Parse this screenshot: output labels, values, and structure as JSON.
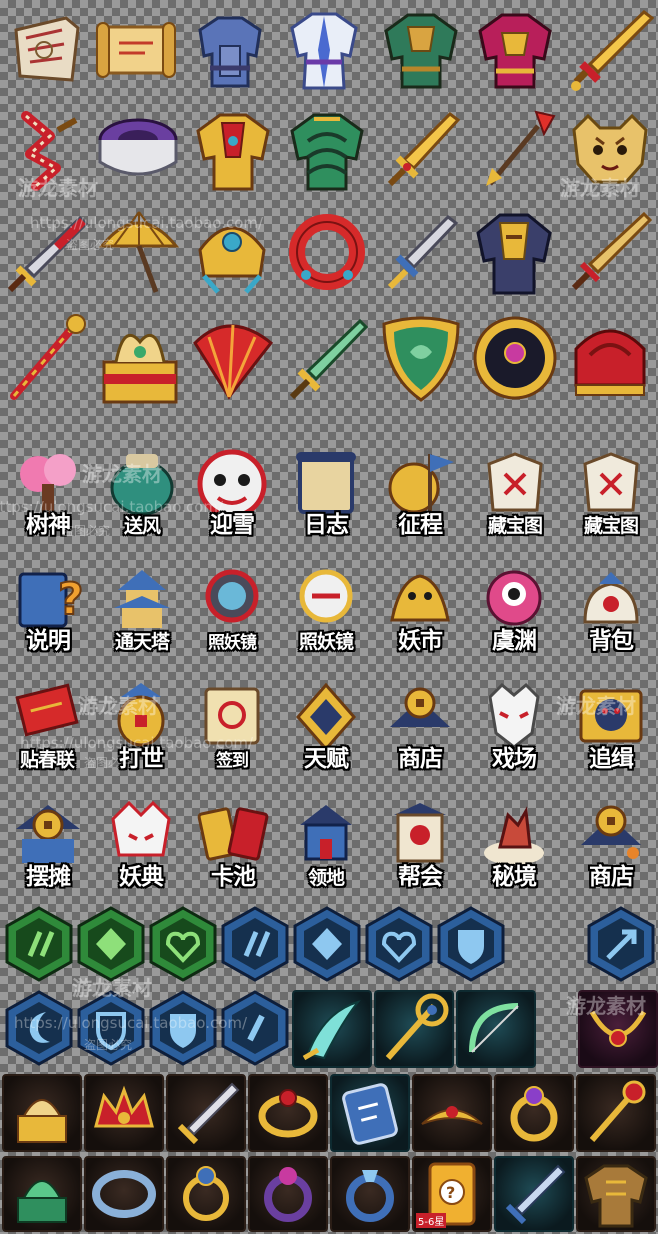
{
  "sheet": {
    "row1_icons": [
      "map-scroll-icon",
      "parchment-scroll-icon",
      "blue-armor-icon",
      "white-robe-icon",
      "green-armor-icon",
      "red-armor-icon",
      "golden-sword-icon"
    ],
    "row2_icons": [
      "red-whip-icon",
      "purple-drum-icon",
      "golden-armor-icon",
      "jade-armor-icon",
      "jeweled-sword-icon",
      "red-spear-icon",
      "tiger-helmet-icon"
    ],
    "row3_icons": [
      "crimson-sword-icon",
      "paper-umbrella-icon",
      "crown-helmet-icon",
      "red-ring-icon",
      "blue-dagger-icon",
      "dark-armor-icon",
      "long-sword-icon"
    ],
    "row4_icons": [
      "golden-staff-icon",
      "phoenix-chest-icon",
      "red-fan-icon",
      "jade-sword-icon",
      "green-shield-icon",
      "eye-orb-icon",
      "red-helmet-icon"
    ],
    "labelled_rows": [
      [
        {
          "label": "树神",
          "icon": "tree-spirit-icon"
        },
        {
          "label": "送风",
          "icon": "wind-jar-icon"
        },
        {
          "label": "迎雪",
          "icon": "lion-mask-icon"
        },
        {
          "label": "日志",
          "icon": "journal-scroll-icon"
        },
        {
          "label": "征程",
          "icon": "journey-flag-icon"
        },
        {
          "label": "藏宝图",
          "icon": "treasure-map-icon"
        },
        {
          "label": "藏宝图",
          "icon": "treasure-map-icon"
        }
      ],
      [
        {
          "label": "说明",
          "icon": "help-scroll-icon"
        },
        {
          "label": "通天塔",
          "icon": "pagoda-icon"
        },
        {
          "label": "照妖镜",
          "icon": "demon-mirror-icon"
        },
        {
          "label": "照妖镜",
          "icon": "demon-mirror-icon"
        },
        {
          "label": "妖市",
          "icon": "demon-market-icon"
        },
        {
          "label": "虞渊",
          "icon": "fish-creature-icon"
        },
        {
          "label": "背包",
          "icon": "bag-icon"
        }
      ],
      [
        {
          "label": "贴春联",
          "icon": "couplet-icon"
        },
        {
          "label": "打世",
          "icon": "lantern-icon"
        },
        {
          "label": "签到",
          "icon": "sign-in-scroll-icon"
        },
        {
          "label": "天赋",
          "icon": "talent-coin-icon"
        },
        {
          "label": "商店",
          "icon": "shop-coins-icon"
        },
        {
          "label": "戏场",
          "icon": "fox-mask-icon"
        },
        {
          "label": "追缉",
          "icon": "wanted-creature-icon"
        }
      ],
      [
        {
          "label": "摆摊",
          "icon": "stall-icon"
        },
        {
          "label": "妖典",
          "icon": "demon-codex-icon"
        },
        {
          "label": "卡池",
          "icon": "card-pool-icon"
        },
        {
          "label": "领地",
          "icon": "territory-icon"
        },
        {
          "label": "帮会",
          "icon": "guild-banner-icon"
        },
        {
          "label": "秘境",
          "icon": "secret-realm-icon"
        },
        {
          "label": "商店",
          "icon": "shop-coins-icon"
        }
      ]
    ],
    "hex_row1": [
      {
        "icon": "hex-slash-icon",
        "color": "green"
      },
      {
        "icon": "hex-diamond-icon",
        "color": "green"
      },
      {
        "icon": "hex-heart-icon",
        "color": "green"
      },
      {
        "icon": "hex-slash-icon",
        "color": "blue"
      },
      {
        "icon": "hex-diamond-icon",
        "color": "blue"
      },
      {
        "icon": "hex-heart-icon",
        "color": "blue"
      },
      {
        "icon": "hex-shield-icon",
        "color": "blue"
      },
      {
        "icon": "hex-arrow-icon",
        "color": "blue"
      }
    ],
    "hex_row2": [
      {
        "icon": "hex-moon-icon",
        "color": "blue"
      },
      {
        "icon": "hex-shield-icon",
        "color": "blue"
      },
      {
        "icon": "hex-shield-icon",
        "color": "blue"
      },
      {
        "icon": "hex-slash-icon",
        "color": "blue"
      }
    ],
    "tiles_row1": [
      "curved-blade-icon",
      "golden-staff-tile-icon",
      "jade-bow-icon",
      "purple-necklace-icon"
    ],
    "tiles_row2": [
      "golden-seal-icon",
      "demon-crown-icon",
      "gilded-sword-icon",
      "ruby-ring-icon",
      "rune-shield-icon",
      "golden-tiara-icon",
      "amethyst-ring-icon",
      "ruby-scepter-icon"
    ],
    "tiles_row3": [
      "jade-seal-icon",
      "silver-bracelet-icon",
      "sapphire-ring-icon",
      "purple-ring-icon",
      "crystal-ring-icon",
      "mystery-card-icon",
      "steel-dagger-icon",
      "bronze-armor-icon"
    ],
    "mystery_card_badge": "5-6星",
    "watermark": {
      "brand": "游龙素材",
      "url": "https://ulongsucai.taobao.com/",
      "notice": "盗图必究"
    },
    "colors": {
      "gold": "#e8b83a",
      "red": "#c8202a",
      "jade": "#2f8f5e",
      "blue": "#3f6fb8",
      "purple": "#6a3fa0",
      "hex_green": "#2f8a3a",
      "hex_blue": "#2c5f9c"
    }
  }
}
